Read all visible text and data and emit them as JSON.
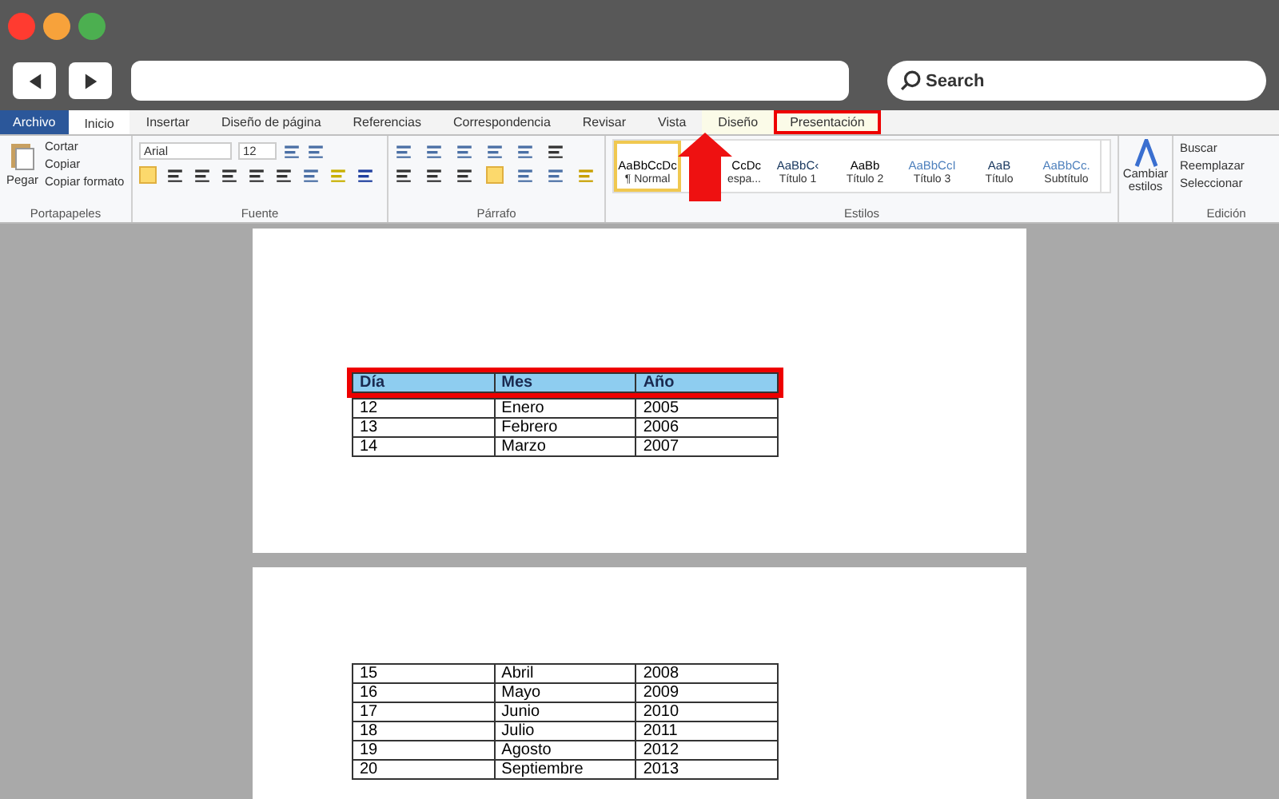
{
  "nav": {
    "search_placeholder": "Search"
  },
  "tabs": [
    {
      "label": "Archivo",
      "kind": "file",
      "selected": false,
      "highlighted": false
    },
    {
      "label": "Inicio",
      "kind": "tab",
      "selected": true,
      "highlighted": false
    },
    {
      "label": "Insertar",
      "kind": "tab",
      "selected": false,
      "highlighted": false
    },
    {
      "label": "Diseño de página",
      "kind": "tab",
      "selected": false,
      "highlighted": false
    },
    {
      "label": "Referencias",
      "kind": "tab",
      "selected": false,
      "highlighted": false
    },
    {
      "label": "Correspondencia",
      "kind": "tab",
      "selected": false,
      "highlighted": false
    },
    {
      "label": "Revisar",
      "kind": "tab",
      "selected": false,
      "highlighted": false
    },
    {
      "label": "Vista",
      "kind": "tab",
      "selected": false,
      "highlighted": false
    },
    {
      "label": "Diseño",
      "kind": "context",
      "selected": false,
      "highlighted": false
    },
    {
      "label": "Presentación",
      "kind": "context",
      "selected": false,
      "highlighted": true
    }
  ],
  "clipboard": {
    "paste": "Pegar",
    "items": [
      "Cortar",
      "Copiar",
      "Copiar formato"
    ],
    "group": "Portapapeles"
  },
  "font": {
    "name": "Arial",
    "size": "12",
    "group": "Fuente"
  },
  "paragraph": {
    "group": "Párrafo"
  },
  "styles": {
    "group": "Estilos",
    "items": [
      {
        "preview": "AaBbCcDc",
        "label": "¶ Normal",
        "selected": true,
        "color": "#000000"
      },
      {
        "preview": "CcDc",
        "label": "espa...",
        "selected": false,
        "color": "#000000"
      },
      {
        "preview": "AaBbC‹",
        "label": "Título 1",
        "selected": false,
        "color": "#17365d"
      },
      {
        "preview": "AaBb",
        "label": "Título 2",
        "selected": false,
        "color": "#000000"
      },
      {
        "preview": "AaBbCcI",
        "label": "Título 3",
        "selected": false,
        "color": "#4f81bd"
      },
      {
        "preview": "AaB",
        "label": "Título",
        "selected": false,
        "color": "#17365d"
      },
      {
        "preview": "AaBbCc.",
        "label": "Subtítulo",
        "selected": false,
        "color": "#4f81bd"
      }
    ],
    "change": "Cambiar estilos"
  },
  "editing": {
    "group": "Edición",
    "items": [
      "Buscar",
      "Reemplazar",
      "Seleccionar"
    ]
  },
  "pages": [
    {
      "header": [
        "Día",
        "Mes",
        "Año"
      ],
      "header_highlighted": true,
      "rows": [
        [
          "12",
          "Enero",
          "2005"
        ],
        [
          "13",
          "Febrero",
          "2006"
        ],
        [
          "14",
          "Marzo",
          "2007"
        ]
      ]
    },
    {
      "rows": [
        [
          "15",
          "Abril",
          "2008"
        ],
        [
          "16",
          "Mayo",
          "2009"
        ],
        [
          "17",
          "Junio",
          "2010"
        ],
        [
          "18",
          "Julio",
          "2011"
        ],
        [
          "19",
          "Agosto",
          "2012"
        ],
        [
          "20",
          "Septiembre",
          "2013"
        ]
      ]
    }
  ]
}
